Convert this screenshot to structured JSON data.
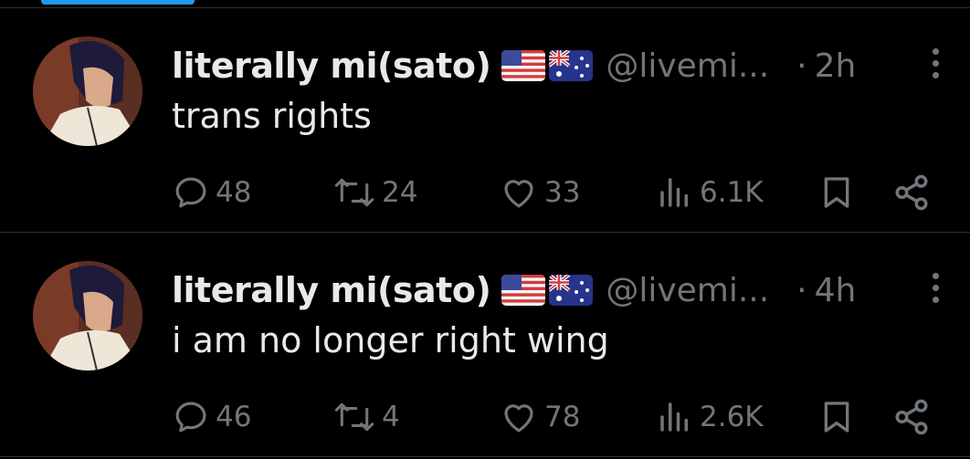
{
  "tweets": [
    {
      "display_name": "literally mi(sato)",
      "flags": [
        "us-flag-icon",
        "au-flag-icon"
      ],
      "handle": "@livemi...",
      "separator": "·",
      "time": "2h",
      "text": "trans rights",
      "replies": "48",
      "reposts": "24",
      "likes": "33",
      "views": "6.1K"
    },
    {
      "display_name": "literally mi(sato)",
      "flags": [
        "us-flag-icon",
        "au-flag-icon"
      ],
      "handle": "@livemi...",
      "separator": "·",
      "time": "4h",
      "text": "i am no longer right wing",
      "replies": "46",
      "reposts": "4",
      "likes": "78",
      "views": "2.6K"
    }
  ],
  "colors": {
    "background": "#000000",
    "text_primary": "#e7e9ea",
    "text_secondary": "#71767b",
    "divider": "#2f3336",
    "accent": "#1d9bf0"
  }
}
